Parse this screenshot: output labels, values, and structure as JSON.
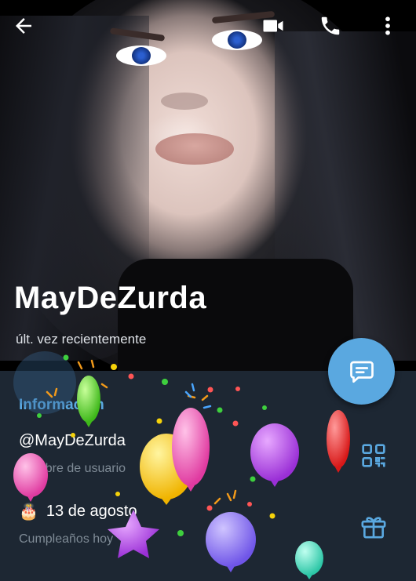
{
  "topbar": {
    "back_icon": "arrow-left-icon",
    "video_icon": "video-camera-icon",
    "call_icon": "phone-icon",
    "more_icon": "more-vertical-icon"
  },
  "profile": {
    "name": "MayDeZurda",
    "status": "últ. vez recientemente"
  },
  "fab": {
    "icon": "message-icon"
  },
  "info": {
    "title": "Información",
    "username": "@MayDeZurda",
    "username_label": "Nombre de usuario",
    "birthday": "13 de agosto",
    "birthday_emoji": "🎂",
    "birthday_label": "Cumpleaños hoy",
    "qr_icon": "qr-code-icon",
    "gift_icon": "gift-icon"
  },
  "colors": {
    "accent": "#5aa8e0",
    "background": "#1d2733",
    "secondary_text": "#7f8b96"
  }
}
